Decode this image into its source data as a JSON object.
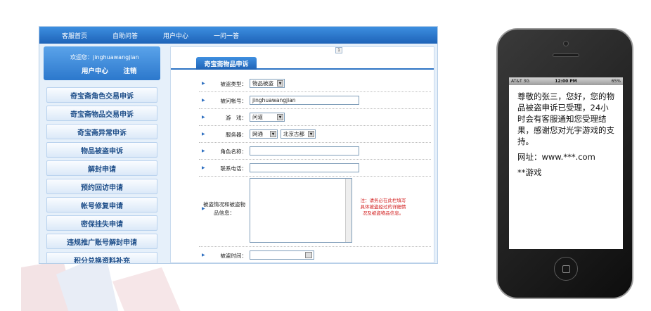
{
  "topnav": [
    "客服首页",
    "自助问答",
    "用户中心",
    "一问一答"
  ],
  "user_panel": {
    "welcome": "欢迎您：jinghuawangjian",
    "links": [
      "用户中心",
      "注销"
    ]
  },
  "sidebar_menu": [
    "奇宝斋角色交易申诉",
    "奇宝斋物品交易申诉",
    "奇宝斋异常申诉",
    "物品被盗申诉",
    "解封申请",
    "预约回访申请",
    "帐号修复申请",
    "密保挂失申请",
    "违规推广账号解封申请",
    "积分兑换资料补充"
  ],
  "content": {
    "pager": "1",
    "tab": "奇宝斋物品申诉",
    "form": {
      "type_label": "被盗类型：",
      "type_value": "物品被盗",
      "account_label": "被问帐号：",
      "account_value": "jinghuawangjian",
      "game_label": "游　戏：",
      "game_value": "问道",
      "server_label": "服务器：",
      "server_value_1": "网通",
      "server_value_2": "北京古都",
      "role_label": "角色名称：",
      "phone_label": "联系电话：",
      "detail_label": "被盗情况和被盗物品信息：",
      "note": "注：请务必在此栏填写具体被盗经过的详细情况及被盗物品信息。",
      "time_label": "被盗时间："
    }
  },
  "phone": {
    "status": {
      "carrier": "AT&T 3G",
      "time": "12:00 PM",
      "battery": "65%"
    },
    "message": "尊敬的张三，您好，您的物品被盗申诉已受理，24小时会有客服通知您受理结果，感谢您对光宇游戏的支持。",
    "website": "网址：www.***.com",
    "signature": "**游戏"
  }
}
